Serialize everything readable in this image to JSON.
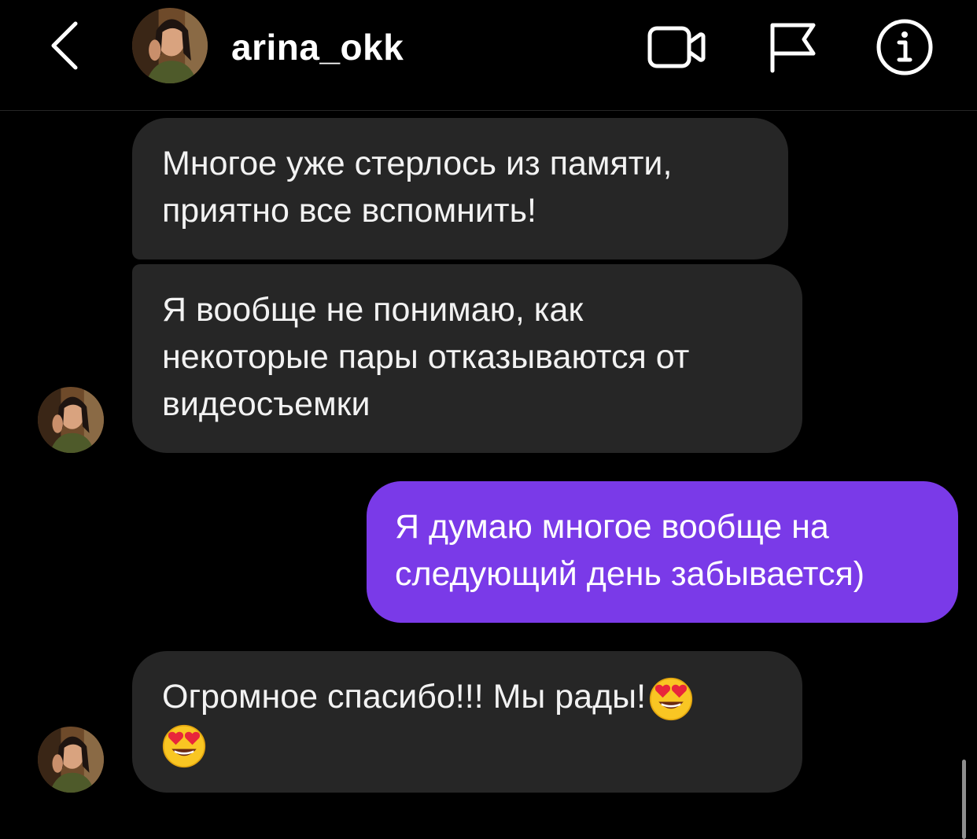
{
  "header": {
    "username": "arina_okk",
    "back_icon": "chevron-left-icon",
    "actions": [
      {
        "name": "video-call",
        "icon": "video-camera-icon"
      },
      {
        "name": "report",
        "icon": "flag-icon"
      },
      {
        "name": "details",
        "icon": "info-icon"
      }
    ]
  },
  "messages": [
    {
      "direction": "incoming",
      "lines": [
        "Многое уже стерлось из памяти,",
        "приятно все вспомнить!"
      ]
    },
    {
      "direction": "incoming",
      "lines": [
        "Я вообще не понимаю, как",
        "некоторые пары отказываются от",
        "видеосъемки"
      ]
    },
    {
      "direction": "outgoing",
      "lines": [
        "Я думаю многое вообще на",
        "следующий день забывается)"
      ]
    },
    {
      "direction": "incoming",
      "lines": [
        "Огромное спасибо!!! Мы рады!"
      ],
      "emoji": "smiling-face-with-heart-eyes"
    }
  ],
  "colors": {
    "background": "#000000",
    "incoming_bubble": "#262626",
    "outgoing_bubble": "#7a3ae8",
    "text": "#ffffff"
  }
}
